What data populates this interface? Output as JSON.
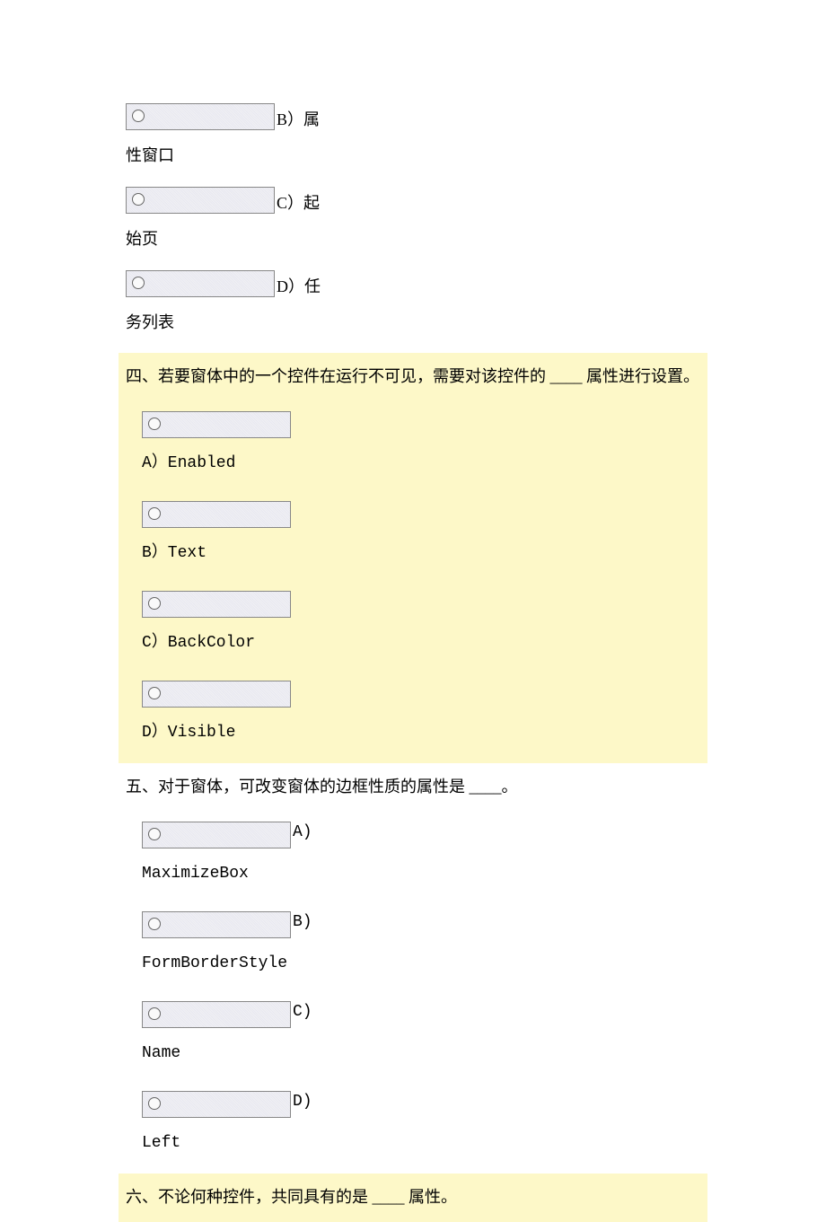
{
  "q3_tail": {
    "options": [
      {
        "letter": "B）",
        "text": "属性窗口"
      },
      {
        "letter": "C）",
        "text": "起始页"
      },
      {
        "letter": "D）",
        "text": "任务列表"
      }
    ]
  },
  "q4": {
    "stem": "四、若要窗体中的一个控件在运行不可见，需要对该控件的 ____ 属性进行设置。",
    "options": [
      {
        "label": "A）Enabled"
      },
      {
        "label": "B）Text"
      },
      {
        "label": "C）BackColor"
      },
      {
        "label": "D）Visible"
      }
    ]
  },
  "q5": {
    "stem": "五、对于窗体，可改变窗体的边框性质的属性是 ____。",
    "options": [
      {
        "letter": "A)",
        "text": "MaximizeBox"
      },
      {
        "letter": "B)",
        "text": "FormBorderStyle"
      },
      {
        "letter": "C)",
        "text": "Name"
      },
      {
        "letter": "D)",
        "text": "Left"
      }
    ]
  },
  "q6": {
    "stem": "六、不论何种控件，共同具有的是 ____ 属性。"
  }
}
